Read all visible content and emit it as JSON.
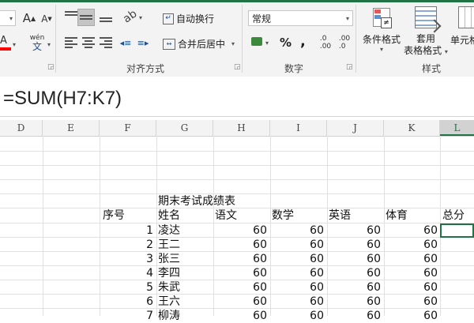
{
  "ribbon": {
    "font": {
      "increase": "A",
      "decrease": "A",
      "phonetic_top": "wén",
      "phonetic_bottom": "文",
      "color_letter": "A"
    },
    "alignment": {
      "wrap_text": "自动换行",
      "merge_center": "合并后居中",
      "group_label": "对齐方式"
    },
    "number": {
      "format_value": "常规",
      "percent": "%",
      "comma": ",",
      "group_label": "数字"
    },
    "styles": {
      "conditional_formatting": "条件格式",
      "format_table_line1": "套用",
      "format_table_line2": "表格格式",
      "cell_styles": "单元格",
      "group_label": "样式"
    }
  },
  "formula_bar": {
    "text": "=SUM(H7:K7)"
  },
  "columns": [
    "D",
    "E",
    "F",
    "G",
    "H",
    "I",
    "J",
    "K",
    "L"
  ],
  "sheet": {
    "title": "期末考试成绩表",
    "headers": {
      "no": "序号",
      "name": "姓名",
      "chinese": "语文",
      "math": "数学",
      "english": "英语",
      "pe": "体育",
      "total": "总分"
    },
    "rows": [
      {
        "no": "1",
        "name": "凌达",
        "chinese": "60",
        "math": "60",
        "english": "60",
        "pe": "60"
      },
      {
        "no": "2",
        "name": "王二",
        "chinese": "60",
        "math": "60",
        "english": "60",
        "pe": "60"
      },
      {
        "no": "3",
        "name": "张三",
        "chinese": "60",
        "math": "60",
        "english": "60",
        "pe": "60"
      },
      {
        "no": "4",
        "name": "李四",
        "chinese": "60",
        "math": "60",
        "english": "60",
        "pe": "60"
      },
      {
        "no": "5",
        "name": "朱武",
        "chinese": "60",
        "math": "60",
        "english": "60",
        "pe": "60"
      },
      {
        "no": "6",
        "name": "王六",
        "chinese": "60",
        "math": "60",
        "english": "60",
        "pe": "60"
      },
      {
        "no": "7",
        "name": "柳涛",
        "chinese": "60",
        "math": "60",
        "english": "60",
        "pe": "60"
      }
    ]
  },
  "colors": {
    "accent": "#217346",
    "font_color_bar": "#ff0000"
  }
}
